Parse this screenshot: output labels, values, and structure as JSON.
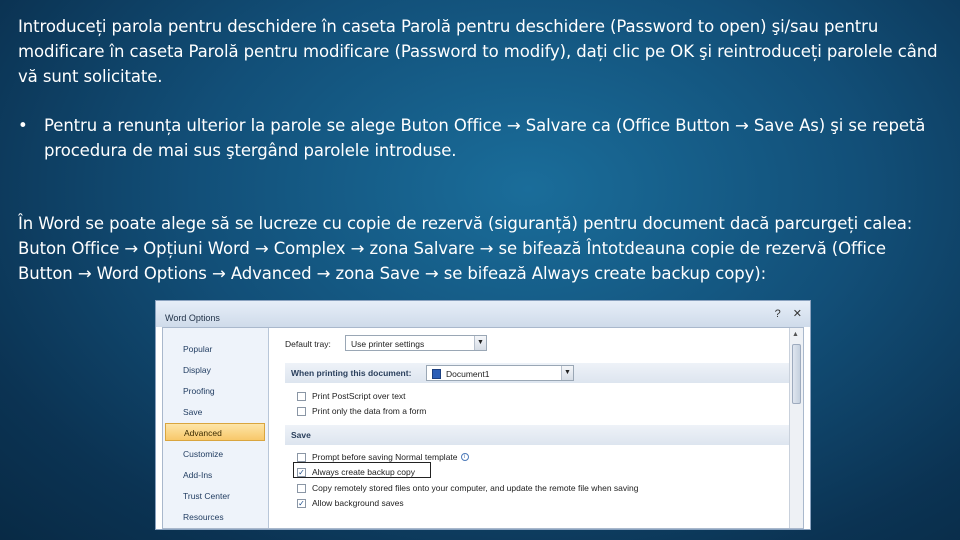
{
  "slide": {
    "paragraph1": "Introduceți parola pentru deschidere în caseta Parolă pentru deschidere (Password to open) şi/sau pentru modificare în caseta Parolă pentru modificare (Password to modify), dați clic pe OK şi reintroduceți parolele când vă sunt solicitate.",
    "bullet_symbol": "•",
    "bullet_text": "Pentru a renunța ulterior la parole se alege Buton Office → Salvare ca (Office Button → Save As) şi se repetă procedura de mai sus ştergând parolele introduse.",
    "paragraph2": "În Word se poate alege să se lucreze cu copie de rezervă (siguranță) pentru document dacă parcurgeți calea: Buton Office → Opțiuni Word → Complex → zona Salvare → se bifează Întotdeauna copie de rezervă (Office Button → Word Options → Advanced → zona Save → se bifează Always create backup copy):"
  },
  "dialog": {
    "title": "Word Options",
    "window_buttons": {
      "help": "?",
      "close": "✕"
    },
    "nav": [
      {
        "label": "Popular",
        "active": false
      },
      {
        "label": "Display",
        "active": false
      },
      {
        "label": "Proofing",
        "active": false
      },
      {
        "label": "Save",
        "active": false
      },
      {
        "label": "Advanced",
        "active": true
      },
      {
        "label": "Customize",
        "active": false
      },
      {
        "label": "Add-Ins",
        "active": false
      },
      {
        "label": "Trust Center",
        "active": false
      },
      {
        "label": "Resources",
        "active": false
      }
    ],
    "default_tray_label": "Default tray:",
    "default_tray_value": "Use printer settings",
    "printing_section_label": "When printing this document:",
    "printing_document_value": "Document1",
    "print_options": [
      {
        "label": "Print PostScript over text",
        "checked": false
      },
      {
        "label": "Print only the data from a form",
        "checked": false
      }
    ],
    "save_section_label": "Save",
    "save_options": [
      {
        "label": "Prompt before saving Normal template",
        "checked": false,
        "info": true
      },
      {
        "label": "Always create backup copy",
        "checked": true,
        "info": false
      },
      {
        "label": "Copy remotely stored files onto your computer, and update the remote file when saving",
        "checked": false,
        "info": false
      },
      {
        "label": "Allow background saves",
        "checked": true,
        "info": false
      }
    ],
    "checkmark": "✓",
    "dropdown_arrow": "▼",
    "scroll_up": "▲",
    "info_symbol": "i",
    "icons": {
      "document": "document-icon",
      "info": "info-icon"
    }
  }
}
